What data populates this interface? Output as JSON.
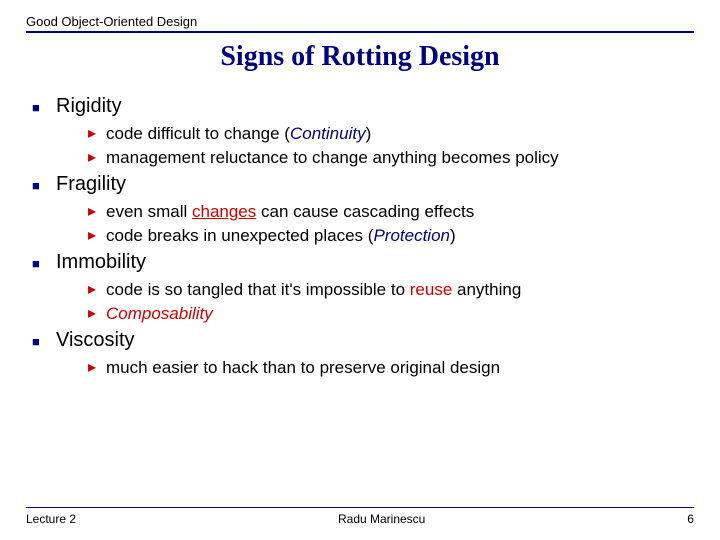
{
  "header": "Good Object-Oriented Design",
  "title": "Signs of Rotting Design",
  "sections": [
    {
      "heading": "Rigidity",
      "items": [
        {
          "pre": "code difficult to change (",
          "em": "Continuity",
          "em_class": "em-navy",
          "post": ")"
        },
        {
          "pre": "management reluctance to change anything becomes policy",
          "em": "",
          "em_class": "",
          "post": ""
        }
      ]
    },
    {
      "heading": "Fragility",
      "items": [
        {
          "pre": "even small ",
          "em": "changes",
          "em_class": "red-u",
          "post": " can cause cascading effects"
        },
        {
          "pre": "code breaks in unexpected places (",
          "em": "Protection",
          "em_class": "em-navy",
          "post": ")"
        }
      ]
    },
    {
      "heading": "Immobility",
      "items": [
        {
          "pre": "code is so tangled that it's impossible to ",
          "em": "reuse",
          "em_class": "red-plain",
          "post": " anything"
        },
        {
          "pre": "",
          "em": "Composability",
          "em_class": "em-red",
          "post": ""
        }
      ]
    },
    {
      "heading": "Viscosity",
      "items": [
        {
          "pre": "much easier to hack than to preserve original design",
          "em": "",
          "em_class": "",
          "post": ""
        }
      ]
    }
  ],
  "footer": {
    "left": "Lecture 2",
    "center": "Radu Marinescu",
    "right": "6"
  }
}
